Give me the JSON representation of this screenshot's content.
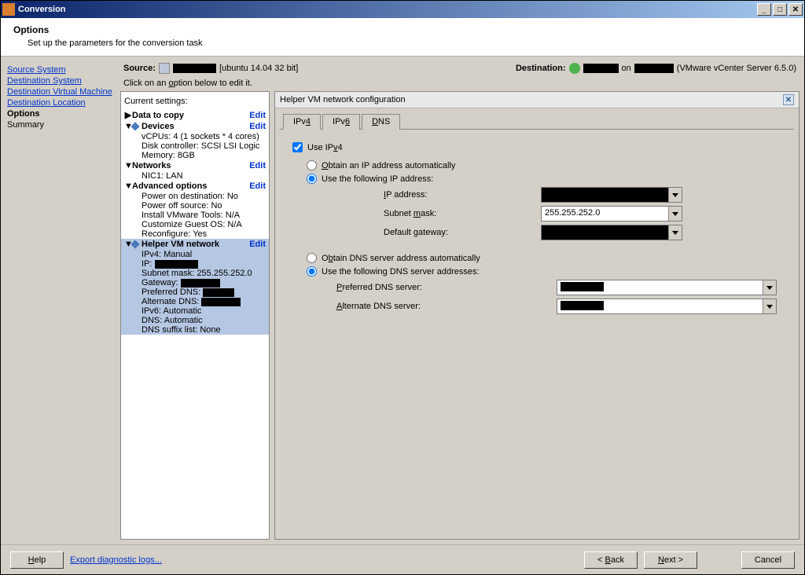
{
  "window": {
    "title": "Conversion"
  },
  "header": {
    "title": "Options",
    "subtitle": "Set up the parameters for the conversion task"
  },
  "sidebar": {
    "items": [
      {
        "label": "Source System",
        "active": false,
        "link": true
      },
      {
        "label": "Destination System",
        "active": false,
        "link": true
      },
      {
        "label": "Destination Virtual Machine",
        "active": false,
        "link": true
      },
      {
        "label": "Destination Location",
        "active": false,
        "link": true
      },
      {
        "label": "Options",
        "active": true,
        "link": false
      },
      {
        "label": "Summary",
        "active": false,
        "link": false
      }
    ]
  },
  "srcdest": {
    "source_label": "Source:",
    "source_suffix": "[ubuntu 14.04 32 bit]",
    "dest_label": "Destination:",
    "dest_on": "on",
    "dest_product": "(VMware vCenter Server 6.5.0)"
  },
  "hint": "Click on an option below to edit it.",
  "tree": {
    "heading": "Current settings:",
    "edit": "Edit",
    "data_to_copy": "Data to copy",
    "devices": "Devices",
    "vcpus": "vCPUs: 4 (1 sockets * 4 cores)",
    "disk_controller": "Disk controller: SCSI LSI Logic",
    "memory": "Memory: 8GB",
    "networks": "Networks",
    "nic1": "NIC1: LAN",
    "advanced": "Advanced options",
    "power_on": "Power on destination: No",
    "power_off": "Power off source: No",
    "install_tools": "Install VMware Tools: N/A",
    "customize": "Customize Guest OS: N/A",
    "reconfigure": "Reconfigure: Yes",
    "helper": "Helper VM network",
    "ipv4_mode": "IPv4: Manual",
    "ip_label": "IP: ",
    "subnet": "Subnet mask: 255.255.252.0",
    "gateway_label": "Gateway: ",
    "pref_dns_label": "Preferred DNS: ",
    "alt_dns_label": "Alternate DNS: ",
    "ipv6_mode": "IPv6: Automatic",
    "dns_mode": "DNS: Automatic",
    "dns_suffix": "DNS suffix list: None"
  },
  "detail": {
    "title": "Helper VM network configuration",
    "tabs": {
      "ipv4": "IPv4",
      "ipv6": "IPv6",
      "dns": "DNS"
    },
    "use_ipv4": "Use IPv4",
    "obtain_ip": "Obtain an IP address automatically",
    "use_ip": "Use the following IP address:",
    "ip_address": "IP address:",
    "subnet_mask": "Subnet mask:",
    "subnet_value": "255.255.252.0",
    "default_gateway": "Default gateway:",
    "obtain_dns": "Obtain DNS server address automatically",
    "use_dns": "Use the following DNS server addresses:",
    "pref_dns": "Preferred DNS server:",
    "alt_dns": "Alternate DNS server:"
  },
  "footer": {
    "help": "Help",
    "export": "Export diagnostic logs...",
    "back": "< Back",
    "next": "Next >",
    "cancel": "Cancel"
  }
}
